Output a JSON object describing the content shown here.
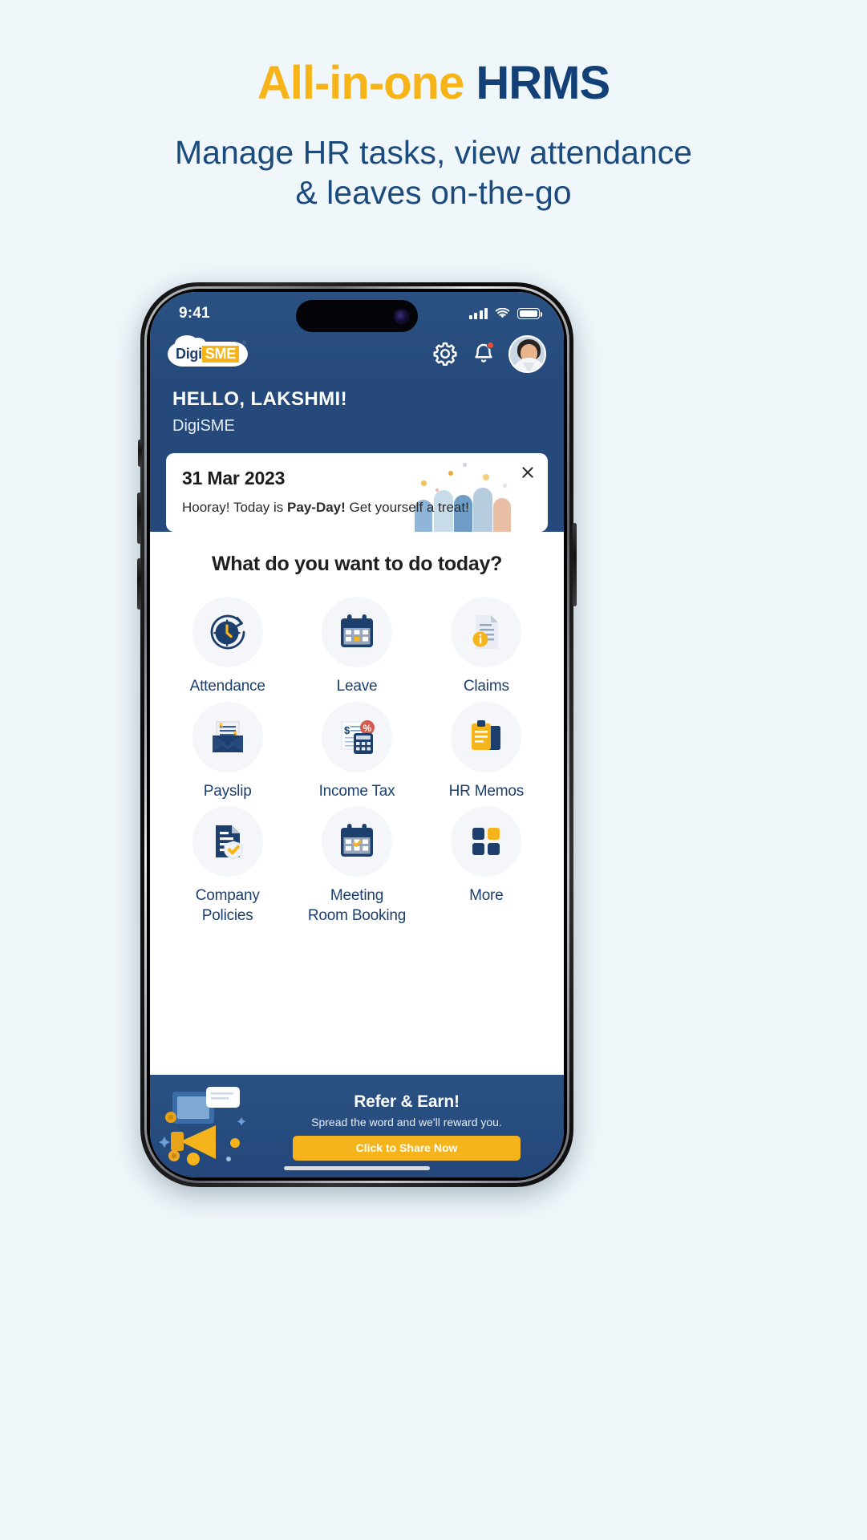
{
  "promo": {
    "title_highlight": "All-in-one",
    "title_rest": "HRMS",
    "subtitle_line1": "Manage HR tasks, view attendance",
    "subtitle_line2": "& leaves on-the-go",
    "highlight_color": "#f7b418",
    "dark_color": "#134076"
  },
  "status_bar": {
    "time": "9:41",
    "signal_icon": "cellular-signal-icon",
    "wifi_icon": "wifi-icon",
    "battery_icon": "battery-icon"
  },
  "app_bar": {
    "logo_first": "Digi",
    "logo_second": "SME",
    "logo_trademark": "®",
    "settings_icon": "gear-icon",
    "notifications_icon": "bell-icon",
    "avatar_icon": "user-avatar"
  },
  "greeting": {
    "hello": "HELLO, LAKSHMI!",
    "organisation": "DigiSME"
  },
  "payday_card": {
    "date": "31 Mar 2023",
    "message_prefix": "Hooray! Today is ",
    "message_bold": "Pay-Day!",
    "message_suffix": " Get yourself a treat!",
    "close_icon": "close-icon"
  },
  "main": {
    "section_title": "What do you want to do today?",
    "tiles": [
      {
        "label": "Attendance",
        "icon": "clock-refresh-icon"
      },
      {
        "label": "Leave",
        "icon": "calendar-icon"
      },
      {
        "label": "Claims",
        "icon": "document-info-icon"
      },
      {
        "label": "Payslip",
        "icon": "envelope-money-icon"
      },
      {
        "label": "Income Tax",
        "icon": "calculator-percent-icon"
      },
      {
        "label": "HR Memos",
        "icon": "clipboard-notes-icon"
      },
      {
        "label": "Company\nPolicies",
        "icon": "document-shield-icon"
      },
      {
        "label": "Meeting\nRoom Booking",
        "icon": "calendar-check-icon"
      },
      {
        "label": "More",
        "icon": "grid-squares-icon"
      }
    ]
  },
  "refer_banner": {
    "heading": "Refer & Earn!",
    "subtext": "Spread the word and we'll reward you.",
    "button_label": "Click to Share Now",
    "art_icon": "megaphone-icon",
    "button_color": "#f5b41c"
  }
}
